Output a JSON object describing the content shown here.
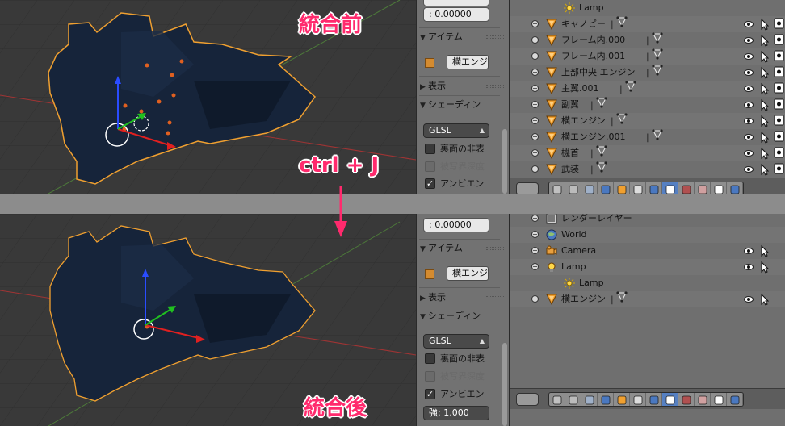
{
  "annotations": {
    "before_title": "統合前",
    "shortcut": "ctrl + J",
    "after_title": "統合後"
  },
  "colors": {
    "accent_annotation": "#ff2a6d",
    "selection_outline": "#f0a030",
    "active_tab": "#5680c2",
    "mesh_fill": "#16243a"
  },
  "top": {
    "props": {
      "value_field_top": "",
      "value_field": ": 0.00000",
      "item_panel": "アイテム",
      "object_name": "横エンジ",
      "display_panel": "表示",
      "shading_panel": "シェーディン"
    },
    "outliner": {
      "rows": [
        {
          "label": "Lamp",
          "icon": "sun-icon",
          "indent": 2
        },
        {
          "label": "キャノピー",
          "icon": "mesh-object-icon",
          "sub": "mesh-data-icon"
        },
        {
          "label": "フレーム内.000",
          "icon": "mesh-object-icon",
          "sub": "mesh-data-icon"
        },
        {
          "label": "フレーム内.001",
          "icon": "mesh-object-icon",
          "sub": "mesh-data-icon"
        },
        {
          "label": "上部中央 エンジン",
          "icon": "mesh-object-icon",
          "sub": "mesh-data-icon"
        },
        {
          "label": "主翼.001",
          "icon": "mesh-object-icon",
          "sub": "mesh-data-icon"
        },
        {
          "label": "副翼",
          "icon": "mesh-object-icon",
          "sub": "mesh-data-icon"
        },
        {
          "label": "横エンジン",
          "icon": "mesh-object-icon",
          "sub": "mesh-data-icon"
        },
        {
          "label": "横エンジン.001",
          "icon": "mesh-object-icon",
          "sub": "mesh-data-icon"
        },
        {
          "label": "機首",
          "icon": "mesh-object-icon",
          "sub": "mesh-data-icon"
        },
        {
          "label": "武装",
          "icon": "mesh-object-icon",
          "sub": "mesh-data-icon"
        }
      ]
    }
  },
  "bottom": {
    "props": {
      "value_field": ": 0.00000",
      "item_panel": "アイテム",
      "object_name": "横エンジ",
      "display_panel": "表示",
      "shading_panel": "シェーディン",
      "shading_mode": "GLSL",
      "backface_label": "裏面の非表",
      "dof_label": "被写界深度",
      "ambient_label": "アンビエン",
      "strength_field": "強:  1.000"
    },
    "outliner": {
      "rows": [
        {
          "label": "レンダーレイヤー",
          "icon": "render-layers-icon"
        },
        {
          "label": "World",
          "icon": "world-icon"
        },
        {
          "label": "Camera",
          "icon": "camera-icon"
        },
        {
          "label": "Lamp",
          "icon": "lamp-icon"
        },
        {
          "label": "Lamp",
          "icon": "sun-icon",
          "indent": 2
        },
        {
          "label": "横エンジン",
          "icon": "mesh-object-icon",
          "sub": "mesh-data-icon"
        }
      ]
    }
  },
  "top_shading": {
    "shading_mode": "GLSL",
    "backface_label": "裏面の非表",
    "dof_label": "被写界深度",
    "ambient_label": "アンビエン"
  }
}
